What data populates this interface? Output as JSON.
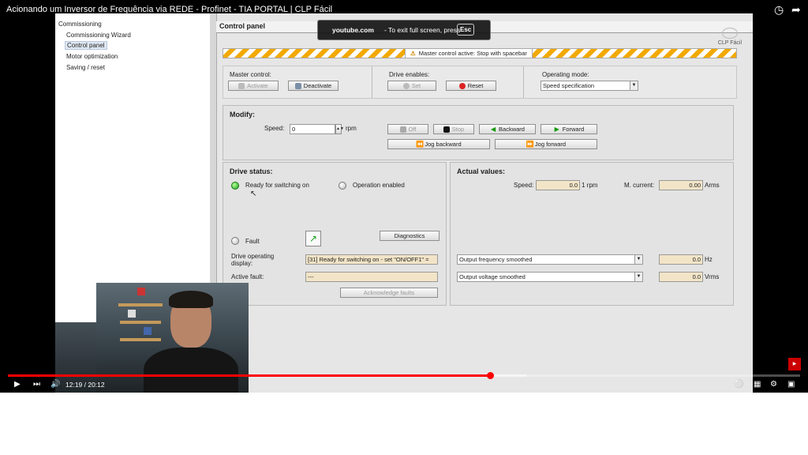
{
  "video_title": "Acionando um Inversor de Frequência via REDE - Profinet - TIA PORTAL | CLP Fácil",
  "tree": {
    "root": "Commissioning",
    "items": [
      "Commissioning Wizard",
      "Control panel",
      "Motor optimization",
      "Saving / reset"
    ]
  },
  "panel_title": "Control panel",
  "brand": "CLP Fácil",
  "fullscreen_toast": {
    "domain": "youtube.com",
    "text": "- To exit full screen, press",
    "key": "Esc"
  },
  "warning": "Master control active: Stop with spacebar",
  "master_control": {
    "label": "Master control:",
    "activate": "Activate",
    "deactivate": "Deactivate"
  },
  "drive_enables": {
    "label": "Drive enables:",
    "set": "Set",
    "reset": "Reset"
  },
  "operating_mode": {
    "label": "Operating mode:",
    "value": "Speed specification"
  },
  "modify": {
    "title": "Modify:",
    "speed_label": "Speed:",
    "speed_value": "0",
    "speed_unit": "rpm",
    "off": "Off",
    "stop": "Stop",
    "backward": "Backward",
    "forward": "Forward",
    "jog_backward": "Jog backward",
    "jog_forward": "Jog forward"
  },
  "drive_status": {
    "title": "Drive status:",
    "ready": "Ready for switching on",
    "operation_enabled": "Operation enabled",
    "fault": "Fault",
    "diagnostics": "Diagnostics",
    "operating_display_label": "Drive operating display:",
    "operating_display_value": "[31] Ready for switching on - set \"ON/OFF1\" =",
    "active_fault_label": "Active fault:",
    "active_fault_value": "---",
    "acknowledge": "Acknowledge faults"
  },
  "actual_values": {
    "title": "Actual values:",
    "speed_label": "Speed:",
    "speed_value": "0.0",
    "speed_unit": "1 rpm",
    "current_label": "M. current:",
    "current_value": "0.00",
    "current_unit": "Arms",
    "freq_select": "Output frequency smoothed",
    "freq_value": "0.0",
    "freq_unit": "Hz",
    "volt_select": "Output voltage smoothed",
    "volt_value": "0.0",
    "volt_unit": "Vrms"
  },
  "player": {
    "time": "12:19 / 20:12",
    "progress_fraction": 0.61
  }
}
